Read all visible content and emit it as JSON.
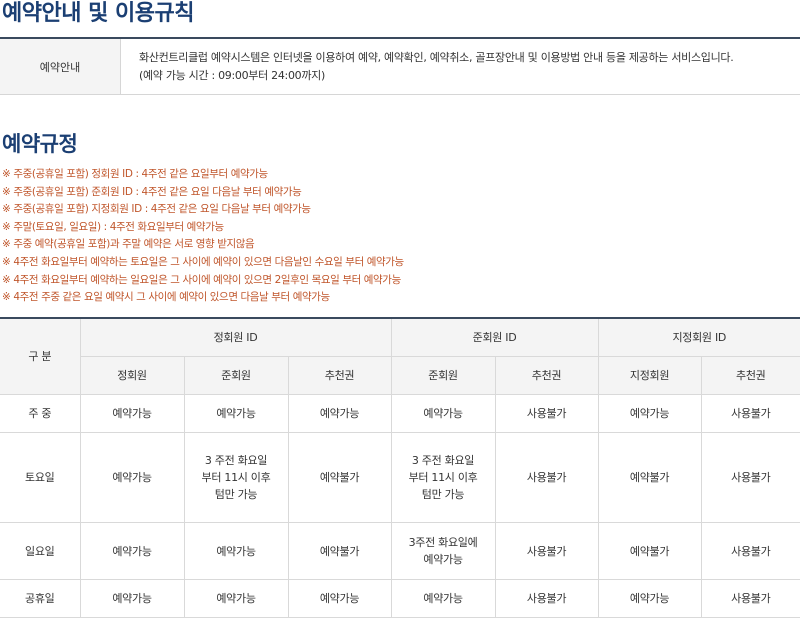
{
  "title": "예약안내 및 이용규칙",
  "intro": {
    "label": "예약안내",
    "line1": "화산컨트리클럽 예약시스템은 인터넷을 이용하여 예약, 예약확인, 예약취소, 골프장안내 및 이용방법 안내 등을 제공하는 서비스입니다.",
    "line2": "(예약 가능 시간 : 09:00부터 24:00까지)"
  },
  "rules_title": "예약규정",
  "rules": [
    "※ 주중(공휴일 포함) 정회원 ID : 4주전 같은 요일부터 예약가능",
    "※ 주중(공휴일 포함) 준회원 ID : 4주전 같은 요일 다음날 부터 예약가능",
    "※ 주중(공휴일 포함) 지정회원 ID : 4주전 같은 요일 다음날 부터 예약가능",
    "※ 주말(토요일, 일요일) : 4주전 화요일부터 예약가능",
    "※ 주중 예약(공휴일 포함)과 주말 예약은 서로 영향 받지않음",
    "※ 4주전 화요일부터 예약하는 토요일은 그 사이에 예약이 있으면 다음날인 수요일 부터 예약가능",
    "※ 4주전 화요일부터 예약하는 일요일은 그 사이에 예약이 있으면 2일후인 목요일 부터 예약가능",
    "※ 4주전 주중 같은 요일 예약시 그 사이에 예약이 있으면 다음날 부터 예약가능"
  ],
  "table": {
    "corner": "구 분",
    "groups": [
      "정회원 ID",
      "준회원 ID",
      "지정회원 ID"
    ],
    "subs": [
      "정회원",
      "준회원",
      "추천권",
      "준회원",
      "추천권",
      "지정회원",
      "추천권"
    ],
    "rows": [
      {
        "day": "주 중",
        "cells": [
          "예약가능",
          "예약가능",
          "예약가능",
          "예약가능",
          "사용불가",
          "예약가능",
          "사용불가"
        ]
      },
      {
        "day": "토요일",
        "cells": [
          "예약가능",
          "3 주전 화요일 부터 11시 이후 텀만 가능",
          "예약불가",
          "3 주전 화요일 부터 11시 이후 텀만 가능",
          "사용불가",
          "예약불가",
          "사용불가"
        ]
      },
      {
        "day": "일요일",
        "cells": [
          "예약가능",
          "예약가능",
          "예약불가",
          "3주전 화요일에 예약가능",
          "사용불가",
          "예약불가",
          "사용불가"
        ]
      },
      {
        "day": "공휴일",
        "cells": [
          "예약가능",
          "예약가능",
          "예약가능",
          "예약가능",
          "사용불가",
          "예약가능",
          "사용불가"
        ]
      }
    ]
  }
}
